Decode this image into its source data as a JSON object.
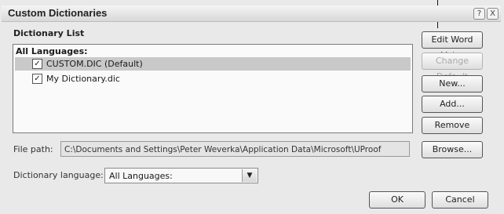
{
  "window": {
    "title": "Custom Dictionaries",
    "help_glyph": "?",
    "close_glyph": "X"
  },
  "dictionary_list": {
    "label": "Dictionary List",
    "group_header": "All Languages:",
    "items": [
      {
        "label": "CUSTOM.DIC (Default)",
        "checked": true,
        "selected": true
      },
      {
        "label": "My Dictionary.dic",
        "checked": true,
        "selected": false
      }
    ],
    "check_glyph": "✓"
  },
  "buttons": {
    "edit_word_list": "Edit Word List...",
    "change_default": "Change Default",
    "new": "New...",
    "add": "Add...",
    "remove": "Remove",
    "browse": "Browse...",
    "ok": "OK",
    "cancel": "Cancel"
  },
  "file_path": {
    "label": "File path:",
    "value": "C:\\Documents and Settings\\Peter Weverka\\Application Data\\Microsoft\\UProof"
  },
  "dictionary_language": {
    "label": "Dictionary language:",
    "value": "All Languages:",
    "arrow_glyph": "▼"
  },
  "colors": {
    "selected_row": "#c9c9c9",
    "disabled_text": "#a9a9a9",
    "dialog_bg": "#e9e9e9"
  }
}
